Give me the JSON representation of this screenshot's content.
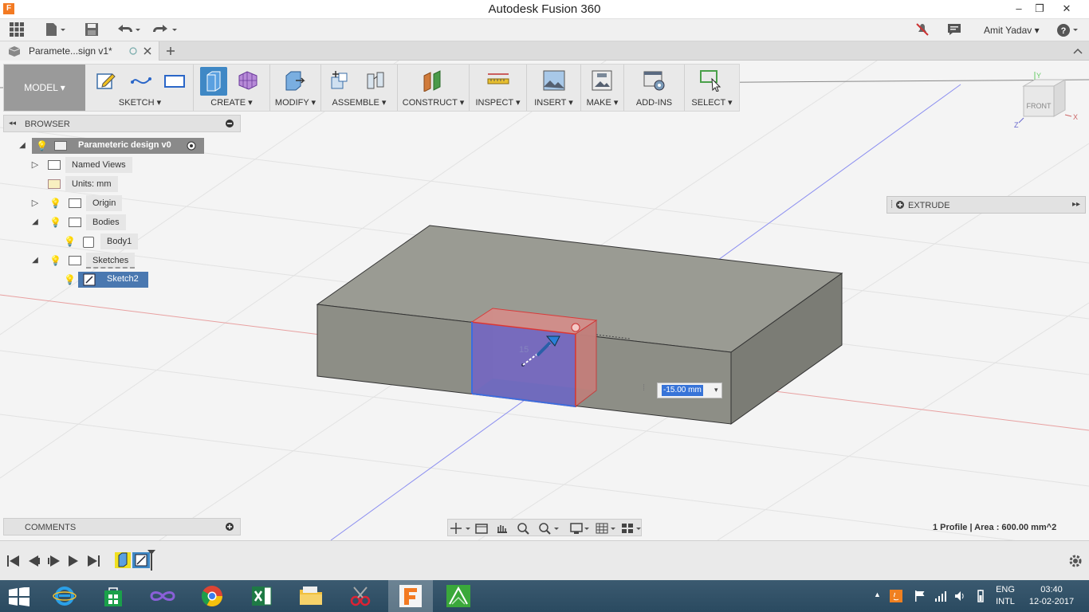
{
  "window": {
    "title": "Autodesk Fusion 360",
    "app_icon_letter": "F",
    "minimize": "–",
    "restore": "❐",
    "close": "✕"
  },
  "quick_access": {
    "user_name": "Amit Yadav",
    "user_menu_arrow": "▾",
    "help": "?"
  },
  "document_tab": {
    "title": "Paramete...sign v1*"
  },
  "toolbar": {
    "workspace": "MODEL",
    "groups": [
      {
        "label": "SKETCH"
      },
      {
        "label": "CREATE"
      },
      {
        "label": "MODIFY"
      },
      {
        "label": "ASSEMBLE"
      },
      {
        "label": "CONSTRUCT"
      },
      {
        "label": "INSPECT"
      },
      {
        "label": "INSERT"
      },
      {
        "label": "MAKE"
      },
      {
        "label": "ADD-INS"
      },
      {
        "label": "SELECT"
      }
    ]
  },
  "browser": {
    "header": "BROWSER",
    "items": [
      {
        "label": "Parameteric design v0"
      },
      {
        "label": "Named Views"
      },
      {
        "label": "Units: mm"
      },
      {
        "label": "Origin"
      },
      {
        "label": "Bodies"
      },
      {
        "label": "Body1"
      },
      {
        "label": "Sketches"
      },
      {
        "label": "Sketch2"
      }
    ]
  },
  "extrude_panel": {
    "title": "EXTRUDE"
  },
  "view_cube": {
    "face": "FRONT",
    "axis_z": "Z",
    "axis_x": "X",
    "axis_y": "Y"
  },
  "extrude_input": {
    "value": "-15.00 mm"
  },
  "scene": {
    "ghost_dimension": "15"
  },
  "comments": {
    "header": "COMMENTS"
  },
  "status": {
    "profile_info": "1 Profile | Area : 600.00 mm^2"
  },
  "taskbar": {
    "language": "ENG",
    "layout": "INTL",
    "time": "03:40",
    "date": "12-02-2017"
  }
}
